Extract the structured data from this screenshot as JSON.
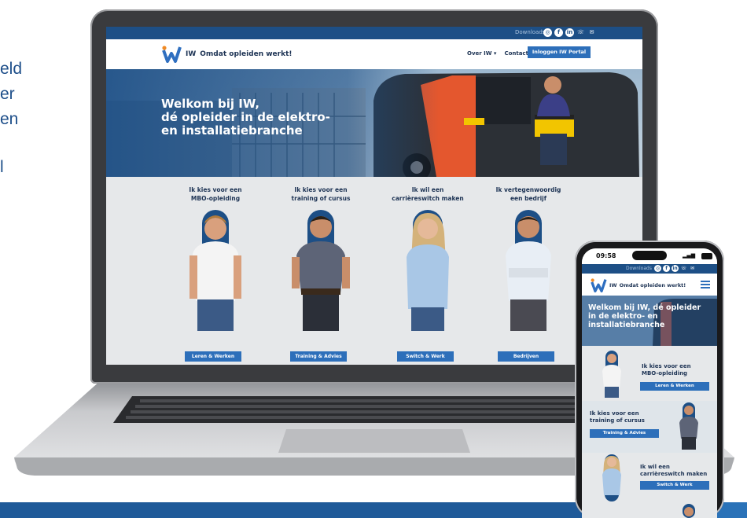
{
  "side_text": [
    "eld",
    "er",
    "en",
    "l"
  ],
  "site": {
    "topbar": {
      "downloads": "Downloads",
      "icons": [
        "instagram-icon",
        "facebook-icon",
        "linkedin-icon",
        "phone-icon",
        "mail-icon"
      ]
    },
    "logo_letters": "IW",
    "tagline": "Omdat opleiden werkt!",
    "nav": {
      "about": "Over IW",
      "about_caret": "▾",
      "contact": "Contact",
      "portal": "Inloggen IW Portal"
    },
    "hero_title": [
      "Welkom bij IW,",
      "dé opleider in de elektro-",
      "en installatiebranche"
    ],
    "cards": [
      {
        "heading": [
          "Ik kies voor een",
          "MBO-opleiding"
        ],
        "button": "Leren & Werken"
      },
      {
        "heading": [
          "Ik kies voor een",
          "training of cursus"
        ],
        "button": "Training & Advies"
      },
      {
        "heading": [
          "Ik wil een",
          "carrièreswitch maken"
        ],
        "button": "Switch & Werk"
      },
      {
        "heading": [
          "Ik vertegenwoordig",
          "een bedrijf"
        ],
        "button": "Bedrijven"
      }
    ]
  },
  "phone": {
    "time": "09:58",
    "downloads": "Downloads",
    "logo_letters": "IW",
    "tagline": "Omdat opleiden werkt!",
    "hero_title": [
      "Welkom bij IW, dé opleider",
      "in de elektro- en",
      "installatiebranche"
    ],
    "rows": [
      {
        "heading": [
          "Ik kies voor een",
          "MBO-opleiding"
        ],
        "button": "Leren & Werken"
      },
      {
        "heading": [
          "Ik kies voor een",
          "training of cursus"
        ],
        "button": "Training & Advies"
      },
      {
        "heading": [
          "Ik wil een",
          "carrièreswitch maken"
        ],
        "button": "Switch & Werk"
      }
    ]
  },
  "colors": {
    "brand_blue": "#1d4f86",
    "button_blue": "#2d6fba",
    "logo_orange": "#f08a24"
  }
}
